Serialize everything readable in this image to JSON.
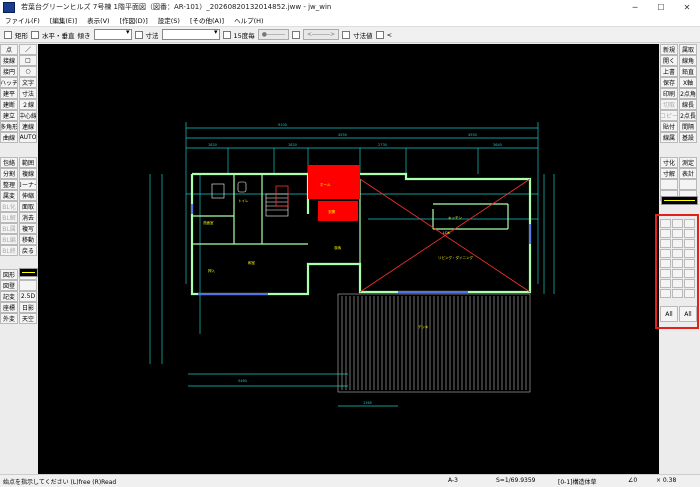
{
  "window": {
    "title": "若葉台グリーンヒルズ 7号棟 1階平面図（図番：AR-101）_20260820132014852.jww - jw_win",
    "minimize": "─",
    "maximize": "☐",
    "close": "✕"
  },
  "menu": [
    "ファイル(F)",
    "[編集(E)]",
    "表示(V)",
    "[作図(D)]",
    "設定(S)",
    "[その他(A)]",
    "ヘルプ(H)"
  ],
  "toolbar": {
    "rect": "矩形",
    "hv": "水平・垂直",
    "tilt": "傾き",
    "dim": "寸法",
    "ratio": "15度毎",
    "btn1": "●―――",
    "btn2": "<―――>",
    "dimval": "寸法値",
    "lt": "<"
  },
  "left_tools": [
    [
      "点",
      "／"
    ],
    [
      "接線",
      "□"
    ],
    [
      "接円",
      "○"
    ],
    [
      "ハッチ",
      "文字"
    ],
    [
      "建平",
      "寸法"
    ],
    [
      "建断",
      "２線"
    ],
    [
      "建立",
      "中心線"
    ],
    [
      "多角形",
      "連線"
    ],
    [
      "曲線",
      "AUTO"
    ],
    [
      "包絡",
      "範囲"
    ],
    [
      "分割",
      "複線"
    ],
    [
      "整理",
      "コーナー"
    ],
    [
      "属変",
      "伸縮"
    ],
    [
      "BL化",
      "面取"
    ],
    [
      "BL解",
      "消去"
    ],
    [
      "BL属",
      "複写"
    ],
    [
      "BL編",
      "移動"
    ],
    [
      "BL終",
      "戻る"
    ],
    [
      "図形",
      ""
    ],
    [
      "図登",
      ""
    ],
    [
      "記変",
      "2.5D"
    ],
    [
      "座標",
      "日影"
    ],
    [
      "外変",
      "天空"
    ]
  ],
  "right_tools": [
    [
      "新規",
      "属取"
    ],
    [
      "開く",
      "線角"
    ],
    [
      "上書",
      "鉛直"
    ],
    [
      "保存",
      "X軸"
    ],
    [
      "印刷",
      "2点角"
    ],
    [
      "切取",
      "線長"
    ],
    [
      "コピー",
      "2点長"
    ],
    [
      "貼付",
      "間隔"
    ],
    [
      "線属",
      "基設"
    ],
    [
      "寸化",
      "測定"
    ],
    [
      "寸解",
      "表計"
    ],
    [
      "",
      ""
    ],
    [
      "",
      ""
    ]
  ],
  "right_small": [
    "All",
    "All"
  ],
  "status": {
    "hint": "始点を指示してください (L)free (R)Read",
    "paper": "A-3",
    "scale": "S=1/69.9359",
    "layer": "[0-1]構造体草",
    "angle": "∠0",
    "zoom": "× 0.38"
  },
  "plan": {
    "room_top": "ホール",
    "room_red": "玄関",
    "room_kitchen": "キッチン",
    "room_living": "リビング・ダイニング",
    "room_japanese": "和室",
    "room_wash": "洗面室",
    "room_toilet": "トイレ",
    "room_deck": "デッキ",
    "room_closet": "押入",
    "room_cl2": "収納",
    "room_ldk_label": "LDK"
  }
}
